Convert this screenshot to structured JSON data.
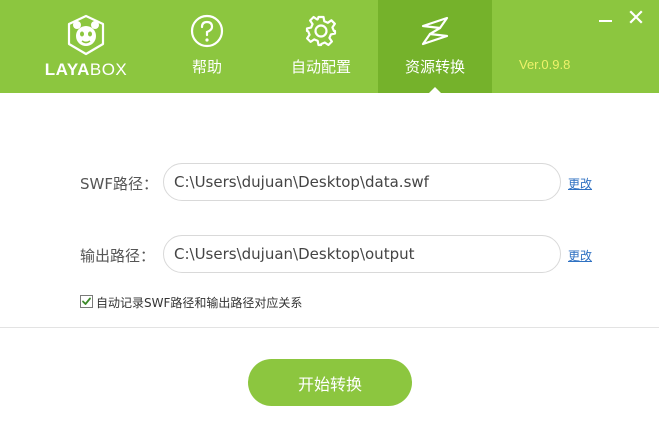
{
  "app": {
    "logo_bold": "LAYA",
    "logo_light": "BOX",
    "version": "Ver.0.9.8"
  },
  "nav": {
    "help": "帮助",
    "auto_config": "自动配置",
    "resource_convert": "资源转换"
  },
  "window": {
    "minimize_icon": "minimize-icon",
    "close_icon": "close-icon"
  },
  "form": {
    "swf_label": "SWF路径：",
    "swf_value": "C:\\Users\\dujuan\\Desktop\\data.swf",
    "output_label": "输出路径：",
    "output_value": "C:\\Users\\dujuan\\Desktop\\output",
    "change_label": "更改",
    "auto_record_label": "自动记录SWF路径和输出路径对应关系",
    "auto_record_checked": true
  },
  "actions": {
    "start_label": "开始转换"
  },
  "colors": {
    "header": "#8cc63f",
    "active_tab": "#75b22b",
    "version_text": "#eef26a",
    "link": "#2f71c2"
  }
}
